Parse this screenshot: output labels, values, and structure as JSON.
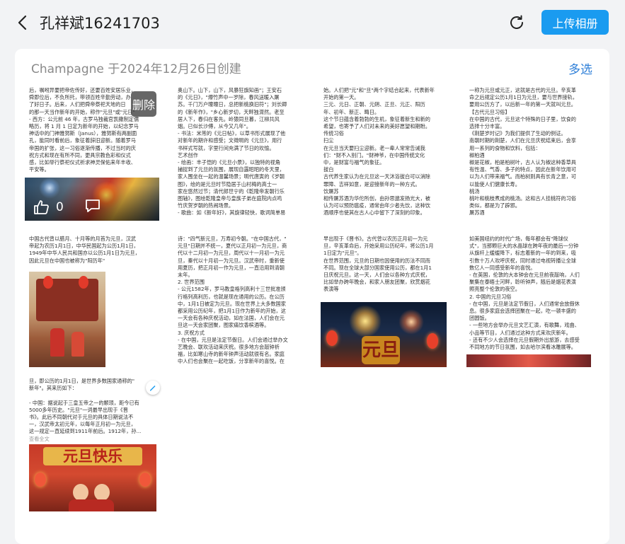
{
  "header": {
    "title": "孔祥斌16241703",
    "upload_label": "上传相册"
  },
  "album": {
    "info": "Champagne  于2024年12月26日创建",
    "multi_select_label": "多选"
  },
  "tile1": {
    "delete_label": "删除",
    "like_count": "0",
    "text": [
      "后，嘱咐异要把帝佐传好，还要百姓安居乐业，",
      "舜即位后，不负所托，带领百姓辛勤劳动，办",
      "了好日子。后来，人们把舜帝祭祀天地的日",
      "的那一天当作新年的开始，称作\"元旦\"或\"元日\"",
      "- 西方：公元前 46 年，古罗马独裁官凯撒制定儒",
      "略历，将 1 月 1 日定为新年的开始，以纪念罗马",
      "神话中的门神雅努斯（Janus），雅努斯有两副面",
      "孔，能同时看前后，象征着辞旧迎新。随着罗马",
      "帝国的扩张，这一习俗逐渐传播，不过当时的庆",
      "祝方式和现在有所不同，更具宗教色彩和仪式",
      "感，比如举行祭祀仪式祈求神灵保佑来年丰收、",
      "平安等。"
    ]
  },
  "tile2": {
    "text": [
      "奥山下。山下，山下，风暴狂旗知画\"；王安石",
      "的《元日》，\"爆竹声中一岁除，春风送暖入屠",
      "苏。千门万户曈曈日，总把新桃换旧符\"；刘长卿",
      "的《新年作》，\"乡心新岁切，天畔独潸然。老至",
      "居人下，春归在客先。岭猿同旦暮，江柳共风",
      "烟。已似长沙傅，从今又几年\"。",
      "- 书法：米芾的《元日帖》，以草书形式展现了他",
      "对新年的期许和感受；文徵明的《元旦》，用行",
      "书样式写就，字里行间充满了节日的欢愉。",
      "  艺术创作",
      "- 绘画：丰子恺的《元旦小景》，以独特的视角",
      "捕捉到了元旦的氛围，展现自露昭昭的冬天里，",
      "家人围坐在一起的温馨场景；明代唐寅的《岁朝",
      "图》，绘的是元旦时节隐居于山村梅的高士一",
      "家在悠然过节；清代郎世宁的《乾隆帝发朝行乐",
      "图轴》，图绘乾隆皇帝与皇族子弟在庭院内点鸣",
      "竹庆贺岁朝的热闹场景。",
      "- 歌曲：如《新年好》，其旋律轻快，歌词简单易"
    ]
  },
  "tile3": {
    "text": [
      "始。人们把\"元\"和\"旦\"两个字结合起来，代表新年",
      "开始的第一天。",
      "三元、元日、正朝、元朔、正旦、元正、阳历",
      "年、初年、新正、晦日。",
      "这个节日蕴含着勃勃的生机，象征着新生和新的",
      "希望，也寄予了人们对未来的美好愿望和期盼。",
      "传统习俗",
      "扫尘",
      "在元旦当天要扫尘迎新。老一辈人常常告诫我",
      "们：\"财不入别门。\"财神爷，在中国传统文化",
      "中，是财富与福气的象征。",
      "拔白",
      "古代养生家认为在元旦这一天沐浴拔白可以消除",
      "罪障、吉祥如意，是迎接新年的一种方式。",
      "饮屠苏",
      "相传屠苏酒为华佗所创，由孙思邈发扬光大，被",
      "认为可以预防瘟疫，通常由年少者先饮，这种饮",
      "酒顺序也使其在古人心中留下了深刻的印象。"
    ]
  },
  "tile4": {
    "text": [
      "一称为元旦或元正，这就是古代的元旦。辛亥革",
      "命之后规定公历1月1日为元旦，要与世界接轨，",
      "要用公历方了，以后新一年的第一天就叫元旦。",
      "【古代元旦习俗】",
      "在中国的古代，元旦这个特殊的日子里，饮食的",
      "选择十分丰富。",
      "《荆楚岁时记》为我们提供了生动的例证。",
      "南朝时期的荆楚，人们在元旦庆祝结束后，会享",
      "用一系列的食物和饮料，包括：",
      "椒柏酒",
      "椒是花椒，柏是柏树叶，古人认为椒这种香草具",
      "有性温、气香、多子的特点，因此在新年饮用可",
      "以为人们带来福气。而柏树则具有长青之意，可",
      "以能使人们健康长寿。",
      "桃汤",
      "桃叶和桃枝煮成的桃汤。这和古人挂桃符的习俗",
      "类似，都是为了辟邪。",
      "屠苏酒"
    ]
  },
  "tile5": {
    "text": [
      "中国古代曾以腊月、十月等的月首为元旦，汉武",
      "帝起为农历1月1日，中华民国起为公历1月1日，",
      "1949年中华人民共和国亦以公历1月1日为元旦，",
      "因此元旦在中国也被称为\"阳历年\""
    ]
  },
  "tile6": {
    "text": [
      "诗：\"四气新元旦，万寿初今朝。\"在中国古代，\"",
      "元旦\"日期并不统一，夏代以正月初一为元旦，商",
      "代以十二月初一为元旦，周代以十一月初一为元",
      "旦，秦代以十月初一为元旦。汉武帝时，重新使",
      "用夏历，把正月初一作为元旦，一直沿用到清朝",
      "末年。",
      "2. 世界范围",
      "- 公元1582年，罗马教皇格列高利十三世批准颁",
      "行格列高利历，也就是现在通用的公历。在公历",
      "中，1月1日被定为元旦。现在世界上大多数国家",
      "都采用公历纪年，把1月1日作为新年的开始，这",
      "一天会有各种庆祝活动，如在法国，人们会在元",
      "旦这一天会家团聚，图家痛饮香槟酒等。",
      "3. 庆祝方式",
      "- 在中国，元旦是法定节假日。人们会通过举办文",
      "艺晚会、联欢活动来庆祝。很多地方会敲钟祈",
      "福，比如寒山寺的新年钟声活动就很有名。家庭",
      "中人们也会聚在一起吃饭，分享新年的喜悦。在"
    ]
  },
  "tile7": {
    "text": [
      "早出现于《晋书》。古代曾以农历正月初一为元",
      "旦，辛亥革命后，开始采用公历纪年，将公历1月",
      "1日定为\"元旦\"。",
      "在世界范围，元旦的日期也因使用的历法不同而",
      "不同。现在全球大部分国家使用公历，都在1月1",
      "日庆祝元旦。这一天，人们会以各种方式庆祝，",
      "比如举办跨年晚会，和家人朋友团聚，欣赏烟花",
      "表演等"
    ],
    "pic_text": "元旦"
  },
  "tile8": {
    "text": [
      "如美国纽约的时代广场，每年都会有\"降球仪",
      "式\"，当那颗巨大的水晶球在跨年夜的最后一分钟",
      "从旗杆上缓缓降下，标志着新的一年的到来，吸",
      "引数十万人欢呼庆祝，同时通过电视转播让全球",
      "数亿人一同感受新年的喜悦。",
      "- 在英国，伦敦的大本钟会在元旦前夜敲响，人们",
      "聚集在泰晤士河畔，聆听钟声，随后是烟花表演",
      "照亮整个伦敦的夜空。",
      "2. 中国的元旦习俗",
      "- 在中国，元旦是法定节假日，人们通常会放假休",
      "息。很多家庭会选择团聚在一起，吃一顿丰盛的",
      "团圆饭。",
      "- 一些地方会举办元旦文艺汇演，有歌舞，戏曲、",
      "小品等节目，人们通过这种方式来欢庆新年。",
      "- 还有不少人会选择在元旦假期外出旅游，去感受",
      "不同地方的节日氛围，如去哈尔滨看冰雕展等。"
    ]
  },
  "tile9": {
    "text": [
      "旦，即公历的1月1日，是世界多数国家通称的\"",
      "新年\"。其来历如下：",
      "",
      "- 中国：据说起于三皇五帝之一的颛顼，距今已有",
      "5000多年历史。\"元旦\"一词最早出现于《晋",
      "书》。此后不同朝代对于元旦的具体日期说法不",
      "一，汉武帝太初元年，以每年正月初一为元旦，",
      "这一规定一直延续到1911年前后。1912年，孙...",
      "查看全文"
    ],
    "pic_text": "元旦快乐"
  }
}
